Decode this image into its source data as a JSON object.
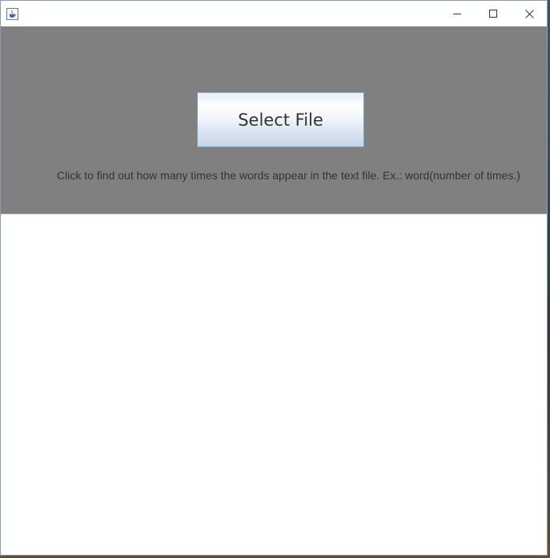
{
  "window": {
    "title": "",
    "icon": "java-cup-icon",
    "controls": {
      "minimize": "minimize-icon",
      "maximize": "maximize-icon",
      "close": "close-icon"
    }
  },
  "main": {
    "select_button_label": "Select File",
    "instruction_text": "Click to find out how many times the words appear in the text file. Ex.: word(number of times.)",
    "output_text": ""
  },
  "colors": {
    "panel_background": "#808080",
    "text_area_background": "#ffffff",
    "button_border": "#7f9db9"
  }
}
